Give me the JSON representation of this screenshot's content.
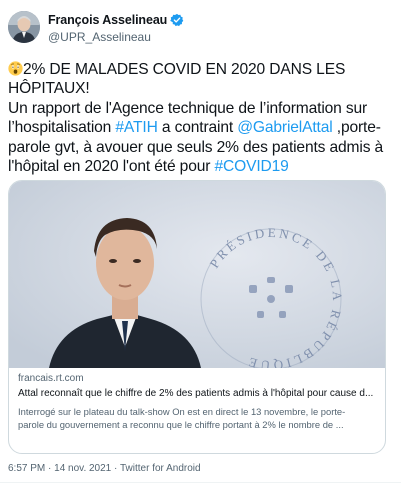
{
  "author": {
    "name": "François Asselineau",
    "handle": "@UPR_Asselineau",
    "verified": true,
    "verified_color": "#1d9bf0"
  },
  "tweet": {
    "emoji": "astonished-face",
    "headline": "2% DE MALADES COVID EN 2020 DANS LES HÔPITAUX!",
    "segments": [
      {
        "text": "Un rapport de l'Agence technique de l’information sur l’hospitalisation ",
        "type": "text"
      },
      {
        "text": "#ATIH",
        "type": "hashtag"
      },
      {
        "text": " a contraint ",
        "type": "text"
      },
      {
        "text": "@GabrielAttal",
        "type": "mention"
      },
      {
        "text": " ,porte-parole gvt, à avouer que seuls 2% des patients admis à l'hôpital en 2020 l'ont été pour ",
        "type": "text"
      },
      {
        "text": "#COVID19",
        "type": "hashtag"
      }
    ],
    "link_color": "#1d9bf0"
  },
  "card": {
    "domain": "francais.rt.com",
    "title": "Attal reconnaît que le chiffre de 2% des patients admis à l'hôpital pour cause d...",
    "description_lines": [
      "Interrogé sur le plateau du talk-show On est en direct le 13 novembre, le porte-",
      "parole du gouvernement a reconnu que le chiffre portant à 2% le nombre de ..."
    ],
    "image_backdrop_text": "PRÉSIDENCE DE LA RÉPUBLIQUE"
  },
  "meta": {
    "time": "6:57 PM",
    "date": "14 nov. 2021",
    "dot": "·",
    "source": "Twitter for Android"
  }
}
